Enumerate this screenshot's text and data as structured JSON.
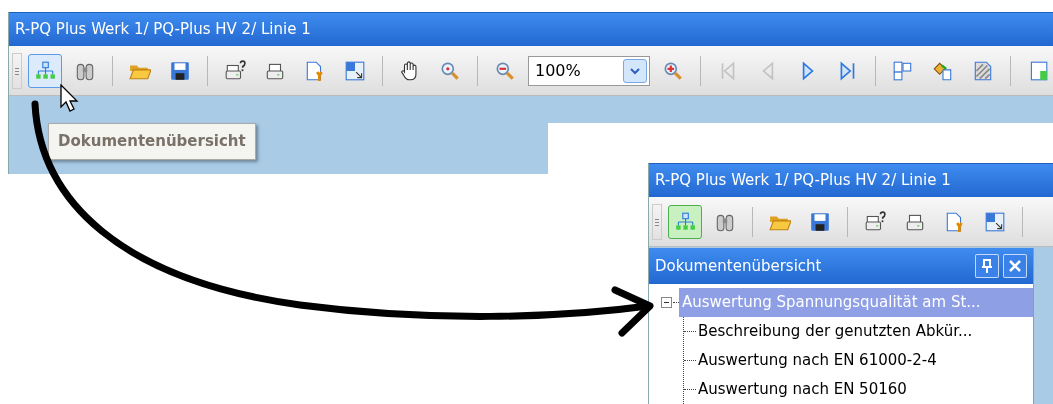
{
  "windows": [
    {
      "title": "R-PQ Plus Werk 1/ PQ-Plus HV 2/ Linie 1",
      "toolbar": [
        {
          "kind": "button",
          "hovered": true,
          "pressed": false,
          "disabled": false
        },
        {
          "kind": "button",
          "hovered": false,
          "pressed": false,
          "disabled": false
        },
        {
          "kind": "separator"
        },
        {
          "kind": "button",
          "hovered": false,
          "pressed": false,
          "disabled": false
        },
        {
          "kind": "button",
          "hovered": false,
          "pressed": false,
          "disabled": false
        },
        {
          "kind": "separator"
        },
        {
          "kind": "button",
          "hovered": false,
          "pressed": false,
          "disabled": false
        },
        {
          "kind": "button",
          "hovered": false,
          "pressed": false,
          "disabled": false
        },
        {
          "kind": "button",
          "hovered": false,
          "pressed": false,
          "disabled": false
        },
        {
          "kind": "button",
          "hovered": false,
          "pressed": false,
          "disabled": false
        },
        {
          "kind": "separator"
        },
        {
          "kind": "button",
          "hovered": false,
          "pressed": false,
          "disabled": false
        },
        {
          "kind": "button",
          "hovered": false,
          "pressed": false,
          "disabled": false
        },
        {
          "kind": "separator"
        },
        {
          "kind": "button",
          "hovered": false,
          "pressed": false,
          "disabled": false
        },
        {
          "kind": "combo",
          "value": "100%"
        },
        {
          "kind": "button",
          "hovered": false,
          "pressed": false,
          "disabled": false
        },
        {
          "kind": "separator"
        },
        {
          "kind": "button",
          "hovered": false,
          "pressed": false,
          "disabled": true
        },
        {
          "kind": "button",
          "hovered": false,
          "pressed": false,
          "disabled": true
        },
        {
          "kind": "button",
          "hovered": false,
          "pressed": false,
          "disabled": false
        },
        {
          "kind": "button",
          "hovered": false,
          "pressed": false,
          "disabled": false
        },
        {
          "kind": "separator"
        },
        {
          "kind": "button",
          "hovered": false,
          "pressed": false,
          "disabled": false
        },
        {
          "kind": "button",
          "hovered": false,
          "pressed": false,
          "disabled": false
        },
        {
          "kind": "button",
          "hovered": false,
          "pressed": false,
          "disabled": false
        },
        {
          "kind": "separator"
        },
        {
          "kind": "button",
          "hovered": false,
          "pressed": false,
          "disabled": false
        }
      ],
      "tooltip": "Dokumentenübersicht"
    },
    {
      "title": "R-PQ Plus Werk 1/ PQ-Plus HV 2/ Linie 1",
      "toolbar": [
        {
          "kind": "button",
          "hovered": false,
          "pressed": true,
          "disabled": false
        },
        {
          "kind": "button",
          "hovered": false,
          "pressed": false,
          "disabled": false
        },
        {
          "kind": "separator"
        },
        {
          "kind": "button",
          "hovered": false,
          "pressed": false,
          "disabled": false
        },
        {
          "kind": "button",
          "hovered": false,
          "pressed": false,
          "disabled": false
        },
        {
          "kind": "separator"
        },
        {
          "kind": "button",
          "hovered": false,
          "pressed": false,
          "disabled": false
        },
        {
          "kind": "button",
          "hovered": false,
          "pressed": false,
          "disabled": false
        },
        {
          "kind": "button",
          "hovered": false,
          "pressed": false,
          "disabled": false
        },
        {
          "kind": "button",
          "hovered": false,
          "pressed": false,
          "disabled": false
        },
        {
          "kind": "separator"
        }
      ],
      "panel": {
        "title": "Dokumentenübersicht",
        "tree": [
          {
            "label": "Auswertung Spannungsqualität  am St...",
            "selected": true,
            "expanded": true,
            "children": [
              {
                "label": "Beschreibung der genutzten Abkür...",
                "selected": false
              },
              {
                "label": "Auswertung nach EN 61000-2-4",
                "selected": false
              },
              {
                "label": "Auswertung nach EN 50160",
                "selected": false
              }
            ]
          }
        ]
      }
    }
  ]
}
